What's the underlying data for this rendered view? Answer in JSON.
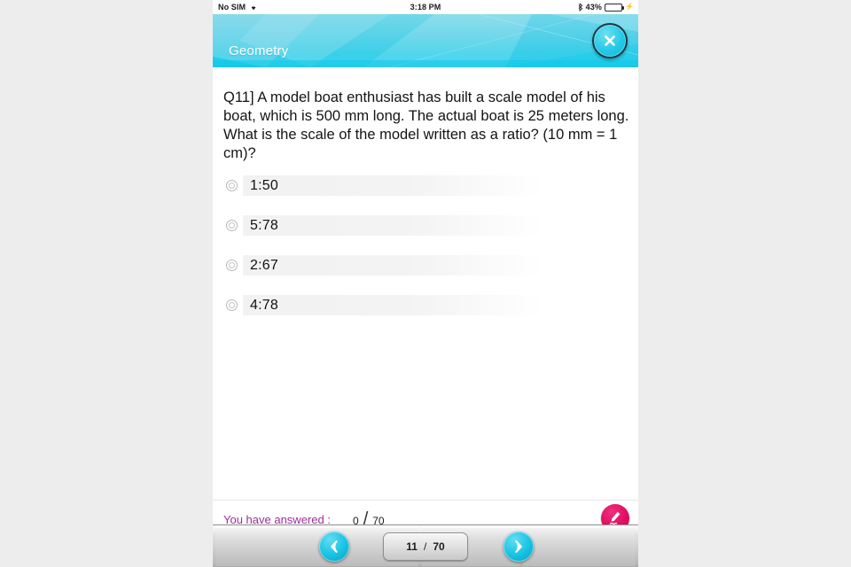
{
  "status_bar": {
    "carrier": "No SIM",
    "wifi_icon": "wifi-icon",
    "time": "3:18 PM",
    "bluetooth_icon": "bluetooth-icon",
    "battery_percent": "43%",
    "battery_level": 43,
    "charging_icon": "charging-bolt-icon"
  },
  "header": {
    "title": "Geometry",
    "close_icon": "close-x-icon",
    "accent_color": "#19cbe8"
  },
  "quiz": {
    "question": "Q11]   A model boat enthusiast has built a scale model of his boat, which is 500 mm long. The actual boat is 25 meters long. What is the scale of the model written as a ratio? (10 mm = 1 cm)?",
    "options": [
      {
        "label": "1:50",
        "selected": false
      },
      {
        "label": "5:78",
        "selected": false
      },
      {
        "label": "2:67",
        "selected": false
      },
      {
        "label": "4:78",
        "selected": false
      }
    ]
  },
  "answered": {
    "label": "You have answered :",
    "count": "0",
    "separator": "/",
    "total": "70",
    "label_color": "#9b2d9b",
    "pen_icon": "pen-signature-icon"
  },
  "toolbar": {
    "prev_icon": "chevron-left-icon",
    "next_icon": "chevron-right-icon",
    "page_current": "11",
    "page_separator": "/",
    "page_total": "70"
  }
}
